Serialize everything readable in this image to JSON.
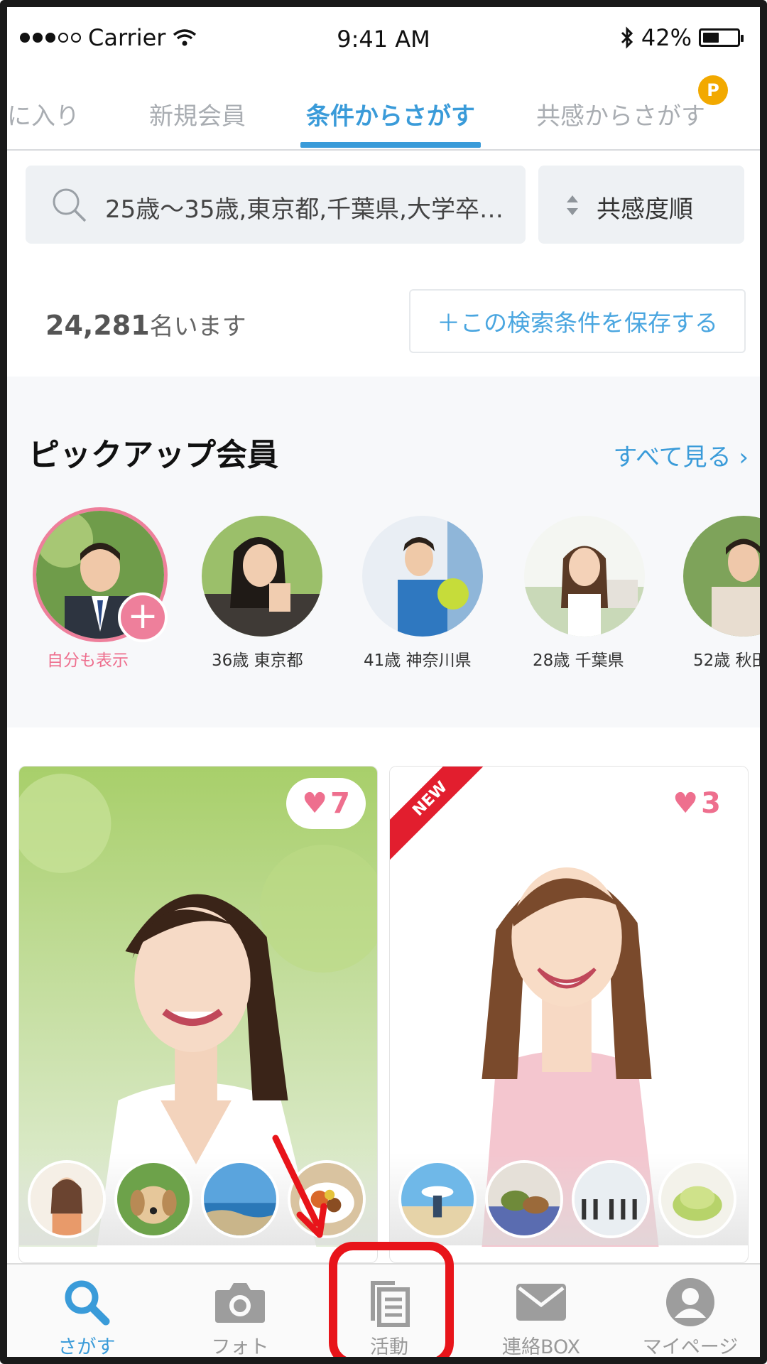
{
  "status_bar": {
    "carrier": "Carrier",
    "time": "9:41 AM",
    "battery": "42%",
    "battery_level": 0.42
  },
  "tabs": [
    {
      "label": "に入り",
      "active": false
    },
    {
      "label": "新規会員",
      "active": false
    },
    {
      "label": "条件からさがす",
      "active": true
    },
    {
      "label": "共感からさがす",
      "active": false
    }
  ],
  "coin_badge": "P",
  "search": {
    "conditions": "25歳〜35歳,東京都,千葉県,大学卒…",
    "sort_label": "共感度順"
  },
  "result": {
    "count": "24,281",
    "count_suffix": "名います",
    "save_button": "＋この検索条件を保存する"
  },
  "pickup": {
    "title": "ピックアップ会員",
    "see_all": "すべて見る ›",
    "members": [
      {
        "label": "自分も表示",
        "self": true
      },
      {
        "label": "36歳 東京都"
      },
      {
        "label": "41歳 神奈川県"
      },
      {
        "label": "28歳 千葉県"
      },
      {
        "label": "52歳 秋田"
      }
    ]
  },
  "cards": [
    {
      "likes": "7",
      "new": false
    },
    {
      "likes": "3",
      "new": true,
      "ribbon": "NEW"
    }
  ],
  "tab_bar": [
    {
      "label": "さがす",
      "icon": "search-icon",
      "active": true
    },
    {
      "label": "フォト",
      "icon": "camera-icon",
      "active": false
    },
    {
      "label": "活動",
      "icon": "activity-icon",
      "active": false
    },
    {
      "label": "連絡BOX",
      "icon": "mail-icon",
      "active": false
    },
    {
      "label": "マイページ",
      "icon": "person-icon",
      "active": false
    }
  ],
  "colors": {
    "accent": "#3a9bd9",
    "pink": "#ee6f8e",
    "annotation_red": "#e8141a"
  }
}
